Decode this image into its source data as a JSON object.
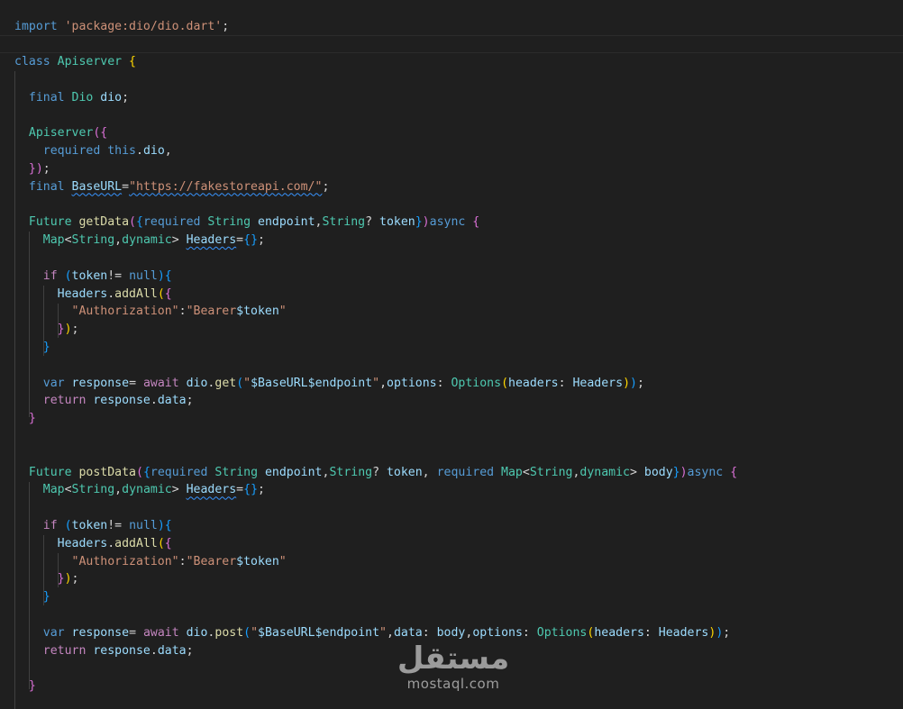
{
  "editor": {
    "language": "dart",
    "theme_background": "#1f1f1f",
    "colors": {
      "keyword": "#569cd6",
      "control": "#c586c0",
      "type": "#4ec9b0",
      "identifier": "#9cdcfe",
      "function": "#dcdcaa",
      "string": "#ce9178",
      "bracket_level1": "#ffd700",
      "bracket_level2": "#da70d6",
      "bracket_level3": "#179fff"
    },
    "lines": [
      [
        [
          "import ",
          "t-kw"
        ],
        [
          "'package:dio/dio.dart'",
          "t-str"
        ],
        [
          ";",
          "t-plain"
        ]
      ],
      [],
      [
        [
          "class ",
          "t-kw"
        ],
        [
          "Apiserver ",
          "t-type"
        ],
        [
          "{",
          "b1"
        ]
      ],
      [],
      [
        [
          "  final ",
          "t-kw"
        ],
        [
          "Dio ",
          "t-type"
        ],
        [
          "dio",
          "t-id"
        ],
        [
          ";",
          "t-plain"
        ]
      ],
      [],
      [
        [
          "  Apiserver",
          "t-type"
        ],
        [
          "({",
          "b2"
        ]
      ],
      [
        [
          "    required ",
          "t-kw"
        ],
        [
          "this",
          "t-kw"
        ],
        [
          ".",
          "t-plain"
        ],
        [
          "dio",
          "t-id"
        ],
        [
          ",",
          "t-plain"
        ]
      ],
      [
        [
          "  })",
          "b2"
        ],
        [
          ";",
          "t-plain"
        ]
      ],
      [
        [
          "  final ",
          "t-kw"
        ],
        [
          "BaseURL",
          "t-id squig"
        ],
        [
          "=",
          "t-plain"
        ],
        [
          "\"https://fakestoreapi.com/\"",
          "t-str squig-str"
        ],
        [
          ";",
          "t-plain"
        ]
      ],
      [],
      [
        [
          "  Future ",
          "t-type"
        ],
        [
          "getData",
          "t-fn"
        ],
        [
          "(",
          "b2"
        ],
        [
          "{",
          "b3"
        ],
        [
          "required ",
          "t-kw"
        ],
        [
          "String ",
          "t-type"
        ],
        [
          "endpoint",
          "t-id"
        ],
        [
          ",",
          "t-plain"
        ],
        [
          "String",
          "t-type"
        ],
        [
          "? ",
          "t-plain"
        ],
        [
          "token",
          "t-id"
        ],
        [
          "}",
          "b3"
        ],
        [
          ")",
          "b2"
        ],
        [
          "async ",
          "t-kw"
        ],
        [
          "{",
          "b2"
        ]
      ],
      [
        [
          "    Map",
          "t-type"
        ],
        [
          "<",
          "t-plain"
        ],
        [
          "String",
          "t-type"
        ],
        [
          ",",
          "t-plain"
        ],
        [
          "dynamic",
          "t-type"
        ],
        [
          "> ",
          "t-plain"
        ],
        [
          "Headers",
          "t-id squig"
        ],
        [
          "=",
          "t-plain"
        ],
        [
          "{}",
          "b3"
        ],
        [
          ";",
          "t-plain"
        ]
      ],
      [],
      [
        [
          "    if ",
          "t-ctrl"
        ],
        [
          "(",
          "b3"
        ],
        [
          "token",
          "t-id"
        ],
        [
          "!= ",
          "t-plain"
        ],
        [
          "null",
          "t-kw"
        ],
        [
          ")",
          "b3"
        ],
        [
          "{",
          "b3"
        ]
      ],
      [
        [
          "      Headers",
          "t-id"
        ],
        [
          ".",
          "t-plain"
        ],
        [
          "addAll",
          "t-fn"
        ],
        [
          "(",
          "b1"
        ],
        [
          "{",
          "b2"
        ]
      ],
      [
        [
          "        \"Authorization\"",
          "t-str"
        ],
        [
          ":",
          "t-plain"
        ],
        [
          "\"Bearer",
          "t-str"
        ],
        [
          "$token",
          "t-id"
        ],
        [
          "\"",
          "t-str"
        ]
      ],
      [
        [
          "      }",
          "b2"
        ],
        [
          ")",
          "b1"
        ],
        [
          ";",
          "t-plain"
        ]
      ],
      [
        [
          "    }",
          "b3"
        ]
      ],
      [],
      [
        [
          "    var ",
          "t-kw"
        ],
        [
          "response",
          "t-id"
        ],
        [
          "= ",
          "t-plain"
        ],
        [
          "await ",
          "t-ctrl"
        ],
        [
          "dio",
          "t-id"
        ],
        [
          ".",
          "t-plain"
        ],
        [
          "get",
          "t-fn"
        ],
        [
          "(",
          "b3"
        ],
        [
          "\"",
          "t-str"
        ],
        [
          "$BaseURL",
          "t-id"
        ],
        [
          "$endpoint",
          "t-id"
        ],
        [
          "\"",
          "t-str"
        ],
        [
          ",",
          "t-plain"
        ],
        [
          "options",
          "t-id"
        ],
        [
          ": ",
          "t-plain"
        ],
        [
          "Options",
          "t-type"
        ],
        [
          "(",
          "b1"
        ],
        [
          "headers",
          "t-id"
        ],
        [
          ": ",
          "t-plain"
        ],
        [
          "Headers",
          "t-id"
        ],
        [
          ")",
          "b1"
        ],
        [
          ")",
          "b3"
        ],
        [
          ";",
          "t-plain"
        ]
      ],
      [
        [
          "    return ",
          "t-ctrl"
        ],
        [
          "response",
          "t-id"
        ],
        [
          ".",
          "t-plain"
        ],
        [
          "data",
          "t-id"
        ],
        [
          ";",
          "t-plain"
        ]
      ],
      [
        [
          "  }",
          "b2"
        ]
      ],
      [],
      [],
      [
        [
          "  Future ",
          "t-type"
        ],
        [
          "postData",
          "t-fn"
        ],
        [
          "(",
          "b2"
        ],
        [
          "{",
          "b3"
        ],
        [
          "required ",
          "t-kw"
        ],
        [
          "String ",
          "t-type"
        ],
        [
          "endpoint",
          "t-id"
        ],
        [
          ",",
          "t-plain"
        ],
        [
          "String",
          "t-type"
        ],
        [
          "? ",
          "t-plain"
        ],
        [
          "token",
          "t-id"
        ],
        [
          ", ",
          "t-plain"
        ],
        [
          "required ",
          "t-kw"
        ],
        [
          "Map",
          "t-type"
        ],
        [
          "<",
          "t-plain"
        ],
        [
          "String",
          "t-type"
        ],
        [
          ",",
          "t-plain"
        ],
        [
          "dynamic",
          "t-type"
        ],
        [
          "> ",
          "t-plain"
        ],
        [
          "body",
          "t-id"
        ],
        [
          "}",
          "b3"
        ],
        [
          ")",
          "b2"
        ],
        [
          "async ",
          "t-kw"
        ],
        [
          "{",
          "b2"
        ]
      ],
      [
        [
          "    Map",
          "t-type"
        ],
        [
          "<",
          "t-plain"
        ],
        [
          "String",
          "t-type"
        ],
        [
          ",",
          "t-plain"
        ],
        [
          "dynamic",
          "t-type"
        ],
        [
          "> ",
          "t-plain"
        ],
        [
          "Headers",
          "t-id squig"
        ],
        [
          "=",
          "t-plain"
        ],
        [
          "{}",
          "b3"
        ],
        [
          ";",
          "t-plain"
        ]
      ],
      [],
      [
        [
          "    if ",
          "t-ctrl"
        ],
        [
          "(",
          "b3"
        ],
        [
          "token",
          "t-id"
        ],
        [
          "!= ",
          "t-plain"
        ],
        [
          "null",
          "t-kw"
        ],
        [
          ")",
          "b3"
        ],
        [
          "{",
          "b3"
        ]
      ],
      [
        [
          "      Headers",
          "t-id"
        ],
        [
          ".",
          "t-plain"
        ],
        [
          "addAll",
          "t-fn"
        ],
        [
          "(",
          "b1"
        ],
        [
          "{",
          "b2"
        ]
      ],
      [
        [
          "        \"Authorization\"",
          "t-str"
        ],
        [
          ":",
          "t-plain"
        ],
        [
          "\"Bearer",
          "t-str"
        ],
        [
          "$token",
          "t-id"
        ],
        [
          "\"",
          "t-str"
        ]
      ],
      [
        [
          "      }",
          "b2"
        ],
        [
          ")",
          "b1"
        ],
        [
          ";",
          "t-plain"
        ]
      ],
      [
        [
          "    }",
          "b3"
        ]
      ],
      [],
      [
        [
          "    var ",
          "t-kw"
        ],
        [
          "response",
          "t-id"
        ],
        [
          "= ",
          "t-plain"
        ],
        [
          "await ",
          "t-ctrl"
        ],
        [
          "dio",
          "t-id"
        ],
        [
          ".",
          "t-plain"
        ],
        [
          "post",
          "t-fn"
        ],
        [
          "(",
          "b3"
        ],
        [
          "\"",
          "t-str"
        ],
        [
          "$BaseURL",
          "t-id"
        ],
        [
          "$endpoint",
          "t-id"
        ],
        [
          "\"",
          "t-str"
        ],
        [
          ",",
          "t-plain"
        ],
        [
          "data",
          "t-id"
        ],
        [
          ": ",
          "t-plain"
        ],
        [
          "body",
          "t-id"
        ],
        [
          ",",
          "t-plain"
        ],
        [
          "options",
          "t-id"
        ],
        [
          ": ",
          "t-plain"
        ],
        [
          "Options",
          "t-type"
        ],
        [
          "(",
          "b1"
        ],
        [
          "headers",
          "t-id"
        ],
        [
          ": ",
          "t-plain"
        ],
        [
          "Headers",
          "t-id"
        ],
        [
          ")",
          "b1"
        ],
        [
          ")",
          "b3"
        ],
        [
          ";",
          "t-plain"
        ]
      ],
      [
        [
          "    return ",
          "t-ctrl"
        ],
        [
          "response",
          "t-id"
        ],
        [
          ".",
          "t-plain"
        ],
        [
          "data",
          "t-id"
        ],
        [
          ";",
          "t-plain"
        ]
      ],
      [],
      [
        [
          "  }",
          "b2"
        ]
      ]
    ]
  },
  "watermark": {
    "arabic": "مستقل",
    "latin": "mostaql.com"
  }
}
